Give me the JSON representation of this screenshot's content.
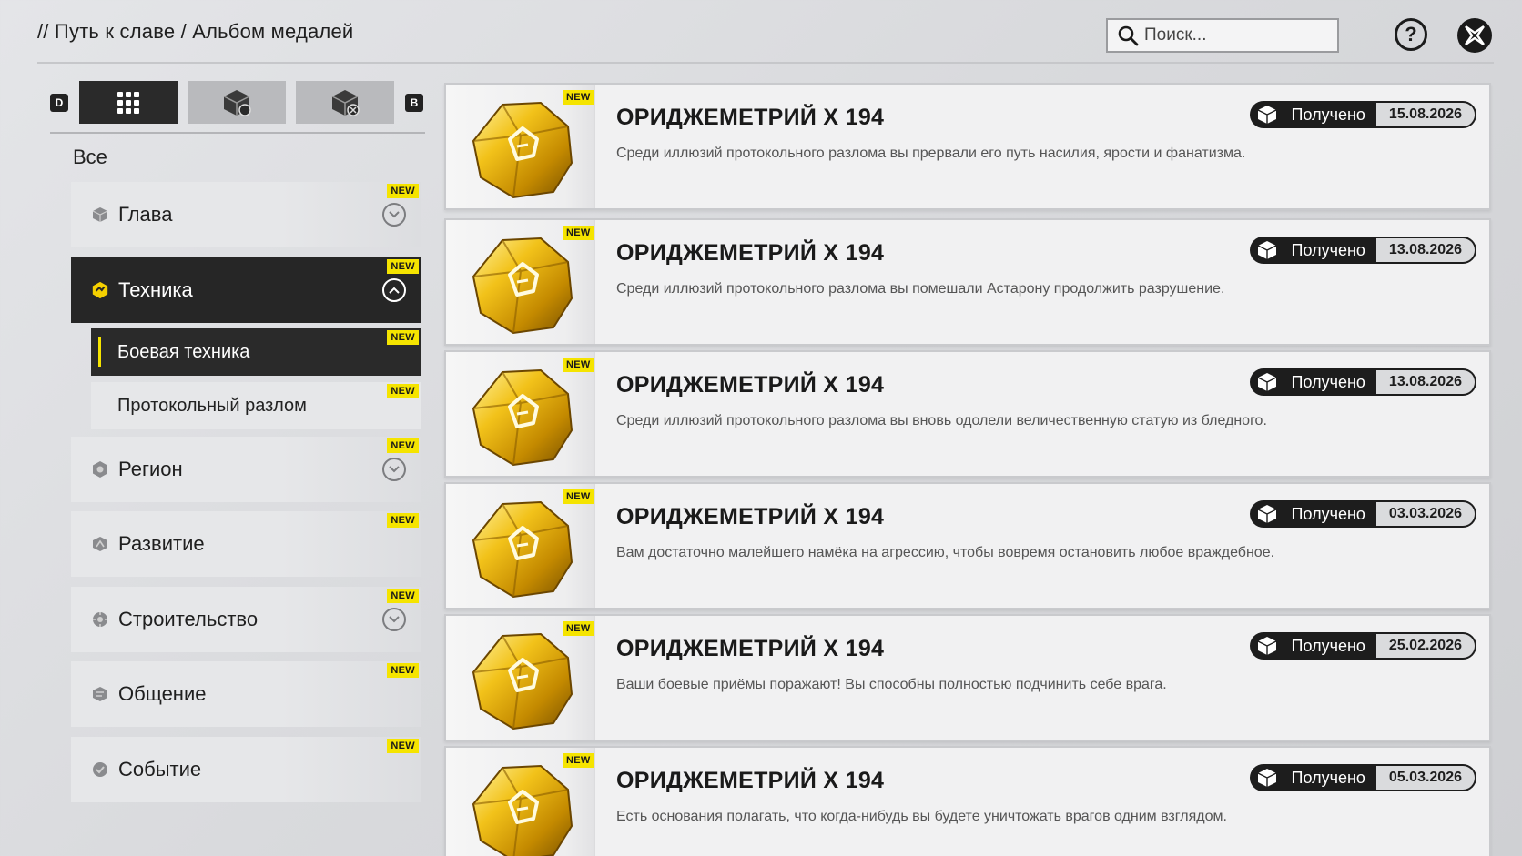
{
  "header": {
    "breadcrumb": "// Путь к славе / Альбом медалей",
    "search_placeholder": "Поиск...",
    "help_label": "?"
  },
  "filter": {
    "key_left": "D",
    "key_right": "B",
    "tabs": [
      "grid-icon",
      "medal-cube-icon",
      "medal-cube-lock-icon"
    ]
  },
  "sidebar": {
    "all_label": "Все",
    "new_label": "NEW",
    "categories": [
      {
        "label": "Глава",
        "expandable": true,
        "expanded": false
      },
      {
        "label": "Техника",
        "expandable": true,
        "expanded": true
      },
      {
        "label": "Регион",
        "expandable": true,
        "expanded": false
      },
      {
        "label": "Развитие",
        "expandable": false
      },
      {
        "label": "Строительство",
        "expandable": true,
        "expanded": false
      },
      {
        "label": "Общение",
        "expandable": false
      },
      {
        "label": "Событие",
        "expandable": false
      }
    ],
    "subcategories": [
      {
        "label": "Боевая техника",
        "active": true
      },
      {
        "label": "Протокольный разлом",
        "active": false
      }
    ]
  },
  "medals": [
    {
      "title": "ОРИДЖЕМЕТРИЙ X 194",
      "desc": "Среди иллюзий протокольного разлома вы прервали его путь насилия, ярости и фанатизма.",
      "status": "Получено",
      "date": "15.08.2026"
    },
    {
      "title": "ОРИДЖЕМЕТРИЙ X 194",
      "desc": "Среди иллюзий протокольного разлома вы помешали Астарону продолжить разрушение.",
      "status": "Получено",
      "date": "13.08.2026"
    },
    {
      "title": "ОРИДЖЕМЕТРИЙ X 194",
      "desc": "Среди иллюзий протокольного разлома вы вновь одолели величественную статую из бледного.",
      "status": "Получено",
      "date": "13.08.2026"
    },
    {
      "title": "ОРИДЖЕМЕТРИЙ X 194",
      "desc": "Вам достаточно малейшего намёка на агрессию, чтобы вовремя остановить любое враждебное.",
      "status": "Получено",
      "date": "03.03.2026"
    },
    {
      "title": "ОРИДЖЕМЕТРИЙ X 194",
      "desc": "Ваши боевые приёмы поражают! Вы способны полностью подчинить себе врага.",
      "status": "Получено",
      "date": "25.02.2026"
    },
    {
      "title": "ОРИДЖЕМЕТРИЙ X 194",
      "desc": "Есть основания полагать, что когда-нибудь вы будете уничтожать врагов одним взглядом.",
      "status": "Получено",
      "date": "05.03.2026"
    }
  ],
  "colors": {
    "accent": "#f5e400",
    "dark": "#1d1d1d",
    "medal_gold": "#e0a800"
  }
}
